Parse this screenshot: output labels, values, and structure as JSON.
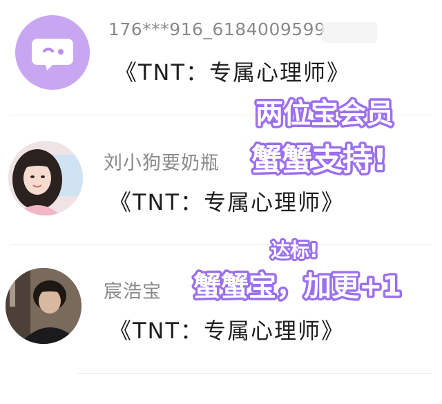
{
  "list": [
    {
      "username": "176***916_6184009599",
      "subtitle": "《TNT：专属心理师》",
      "avatar_icon": "chat-bubble-wink-icon"
    },
    {
      "username": "刘小狗要奶瓶",
      "subtitle": "《TNT：专属心理师》",
      "avatar_icon": "user-photo-girl"
    },
    {
      "username": "宸浩宝",
      "subtitle": "《TNT：专属心理师》",
      "avatar_icon": "user-photo-boy"
    }
  ],
  "overlay": {
    "line1": "两位宝会员",
    "line2": "蟹蟹支持!",
    "line3": "达标!",
    "line4": "蟹蟹宝，加更+1"
  },
  "colors": {
    "overlay_fill": "#ffffff",
    "overlay_stroke": "#9b6ff0",
    "avatar_purple": "#c9a6f2",
    "username_gray": "#8a8a8a",
    "subtitle_dark": "#1f1f1f"
  }
}
